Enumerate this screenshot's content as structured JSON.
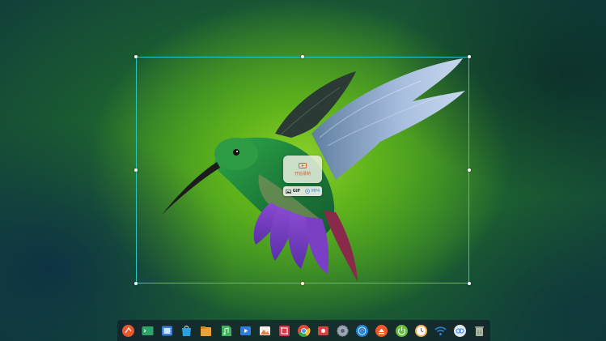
{
  "recorder": {
    "record_label": "开始录制",
    "format_gif": "GIF",
    "format_mp4": "MP4"
  },
  "dock": {
    "items": [
      {
        "name": "launcher-icon",
        "color": "#e9572f"
      },
      {
        "name": "terminal-icon",
        "color": "#2da56a"
      },
      {
        "name": "multitasking-icon",
        "color": "#3b7fd8"
      },
      {
        "name": "app-store-icon",
        "color": "#2e9fe0"
      },
      {
        "name": "file-manager-icon",
        "color": "#e9a13a"
      },
      {
        "name": "music-icon",
        "color": "#3db35c"
      },
      {
        "name": "video-player-icon",
        "color": "#2b7de0"
      },
      {
        "name": "image-viewer-icon",
        "color": "#e67840"
      },
      {
        "name": "screenshot-icon",
        "color": "#e0354b"
      },
      {
        "name": "chrome-icon",
        "color": "#3ea0e5"
      },
      {
        "name": "screen-recorder-icon",
        "color": "#e04040"
      },
      {
        "name": "settings-icon",
        "color": "#a0a8b8"
      },
      {
        "name": "deepin-icon",
        "color": "#1f86d8"
      },
      {
        "name": "installer-icon",
        "color": "#f0582c"
      },
      {
        "name": "power-icon",
        "color": "#64c038"
      },
      {
        "name": "clock-icon",
        "color": "#f2b056"
      },
      {
        "name": "wifi-icon",
        "color": "#2b8de3"
      },
      {
        "name": "desktop-switch-icon",
        "color": "#dfe6ec"
      },
      {
        "name": "trash-icon",
        "color": "#aab8a0"
      }
    ]
  }
}
